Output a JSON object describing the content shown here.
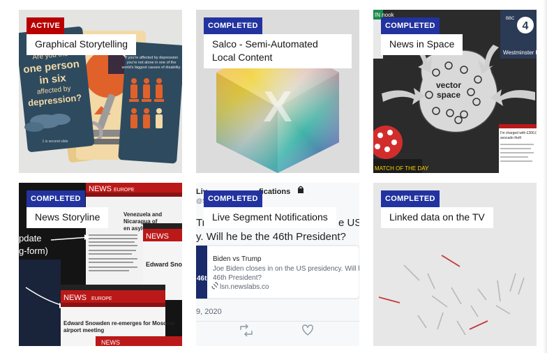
{
  "cards": [
    {
      "status": "ACTIVE",
      "title": "Graphical Storytelling",
      "art_text": {
        "left_card": "Are you the one person in six affected by depression?",
        "left_footer": "1  is  second slide",
        "right_card": "If you're affected by depression you're not alone in one of the world's biggest causes of disability."
      }
    },
    {
      "status": "COMPLETED",
      "title": "Salco - Semi-Automated Local Content",
      "art_text": {
        "logo_letter": "X"
      }
    },
    {
      "status": "COMPLETED",
      "title": "News in Space",
      "art_text": {
        "diagram_label": "vector space",
        "radio_badge": "BBC RADIO 4",
        "radio_caption": "Westminster Ho",
        "news_headline": "'I'm charged with £300,000 avocado theft",
        "sport_caption": "MATCH OF THE DAY",
        "top_left": "IN nook"
      }
    },
    {
      "status": "COMPLETED",
      "title": "News Storyline",
      "art_text": {
        "header_top": "NEWS EUROPE",
        "headline_top": "Venezuela and Nicaragua of an asylum",
        "header_mid": "NEWS EUROPE",
        "headline_mid": "Edward Snowd",
        "header_bottom": "NEWS EUROPE",
        "headline_bottom": "Edward Snowden re-emerges for Moscow airport meeting",
        "side_text_1": "pdate",
        "side_text_2": "g-form)",
        "footer_header": "NEWS"
      }
    },
    {
      "status": "COMPLETED",
      "title": "Live Segment Notifications",
      "art_text": {
        "tweet_header": "Live Segment Notifications",
        "tweet_handle": "@lsn",
        "tweet_body_line1": "Tr",
        "tweet_body_suffix": "e US",
        "tweet_body_line2": "y. Will he be the 46th President?",
        "link_title": "Biden vs Trump",
        "link_desc": "Joe Biden closes in on the US presidency. Will he be the 46th President?",
        "link_url": "lsn.newslabs.co",
        "thumb_number": "46th",
        "date": "9, 2020"
      }
    },
    {
      "status": "COMPLETED",
      "title": "Linked data on the TV",
      "art_text": {}
    }
  ],
  "colors": {
    "active": "#b80000",
    "completed": "#2233a0",
    "bbc_red": "#bb1919"
  },
  "icons": [
    "lock-icon",
    "retweet-icon",
    "heart-icon",
    "link-icon"
  ]
}
